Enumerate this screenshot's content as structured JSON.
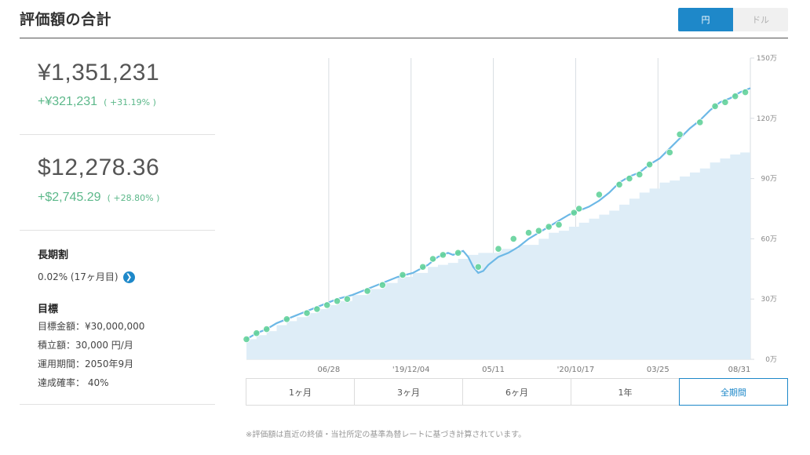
{
  "header": {
    "title": "評価額の合計",
    "currency_yen": "円",
    "currency_usd": "ドル"
  },
  "summary": {
    "yen_total": "¥1,351,231",
    "yen_gain": "+¥321,231",
    "yen_gain_pct": "( +31.19% )",
    "usd_total": "$12,278.36",
    "usd_gain": "+$2,745.29",
    "usd_gain_pct": "( +28.80% )"
  },
  "long_term": {
    "heading": "長期割",
    "value": "0.02% (17ヶ月目)",
    "arrow": "❯"
  },
  "goal": {
    "heading": "目標",
    "amount": "目標金額：¥30,000,000",
    "monthly": "積立額：30,000 円/月",
    "period": "運用期間：2050年9月",
    "probability": "達成確率： 40%"
  },
  "period_tabs": [
    "1ヶ月",
    "3ヶ月",
    "6ヶ月",
    "1年",
    "全期間"
  ],
  "active_period_index": 4,
  "footnote": "※評価額は直近の終値・当社所定の基準為替レートに基づき計算されています。",
  "chart_data": {
    "type": "area",
    "x_tick_labels": [
      "06/28",
      "'19/12/04",
      "05/11",
      "'20/10/17",
      "03/25",
      "08/31"
    ],
    "y_tick_labels": [
      "0万",
      "30万",
      "60万",
      "90万",
      "120万",
      "150万"
    ],
    "ylim": [
      0,
      150
    ],
    "y_unit": "万",
    "grid": "vertical",
    "colors": {
      "line": "#6cb8e6",
      "fill": "#deedf7",
      "marker": "#63d29a",
      "grid": "#d8dde2"
    },
    "series": [
      {
        "values": [
          [
            0,
            10
          ],
          [
            0.02,
            13
          ],
          [
            0.04,
            15
          ],
          [
            0.06,
            18
          ],
          [
            0.08,
            20
          ],
          [
            0.1,
            22
          ],
          [
            0.12,
            24
          ],
          [
            0.14,
            26
          ],
          [
            0.16,
            28
          ],
          [
            0.18,
            30
          ],
          [
            0.21,
            32
          ],
          [
            0.24,
            35
          ],
          [
            0.27,
            38
          ],
          [
            0.3,
            41
          ],
          [
            0.33,
            43
          ],
          [
            0.36,
            47
          ],
          [
            0.38,
            51
          ],
          [
            0.4,
            53
          ],
          [
            0.41,
            52
          ],
          [
            0.42,
            53
          ],
          [
            0.43,
            54
          ],
          [
            0.44,
            51
          ],
          [
            0.45,
            46
          ],
          [
            0.46,
            43
          ],
          [
            0.47,
            44
          ],
          [
            0.48,
            47
          ],
          [
            0.5,
            51
          ],
          [
            0.52,
            53
          ],
          [
            0.54,
            56
          ],
          [
            0.56,
            60
          ],
          [
            0.58,
            63
          ],
          [
            0.6,
            66
          ],
          [
            0.62,
            69
          ],
          [
            0.64,
            72
          ],
          [
            0.66,
            74
          ],
          [
            0.68,
            76
          ],
          [
            0.7,
            79
          ],
          [
            0.72,
            83
          ],
          [
            0.74,
            88
          ],
          [
            0.76,
            91
          ],
          [
            0.78,
            93
          ],
          [
            0.8,
            97
          ],
          [
            0.82,
            100
          ],
          [
            0.84,
            105
          ],
          [
            0.86,
            110
          ],
          [
            0.88,
            115
          ],
          [
            0.9,
            119
          ],
          [
            0.92,
            124
          ],
          [
            0.94,
            128
          ],
          [
            0.96,
            130
          ],
          [
            0.98,
            133
          ],
          [
            1.0,
            135
          ]
        ]
      },
      {
        "values": [
          [
            0,
            10
          ],
          [
            0.02,
            12
          ],
          [
            0.04,
            14
          ],
          [
            0.06,
            17
          ],
          [
            0.08,
            19
          ],
          [
            0.1,
            21
          ],
          [
            0.12,
            23
          ],
          [
            0.14,
            25
          ],
          [
            0.16,
            27
          ],
          [
            0.18,
            29
          ],
          [
            0.21,
            32
          ],
          [
            0.24,
            35
          ],
          [
            0.27,
            38
          ],
          [
            0.3,
            41
          ],
          [
            0.33,
            43
          ],
          [
            0.36,
            46
          ],
          [
            0.38,
            47
          ],
          [
            0.4,
            48
          ],
          [
            0.42,
            50
          ],
          [
            0.44,
            52
          ],
          [
            0.46,
            53
          ],
          [
            0.5,
            55
          ],
          [
            0.54,
            57
          ],
          [
            0.58,
            60
          ],
          [
            0.6,
            63
          ],
          [
            0.62,
            64
          ],
          [
            0.64,
            66
          ],
          [
            0.66,
            68
          ],
          [
            0.68,
            70
          ],
          [
            0.7,
            72
          ],
          [
            0.72,
            74
          ],
          [
            0.74,
            77
          ],
          [
            0.76,
            80
          ],
          [
            0.78,
            83
          ],
          [
            0.8,
            85
          ],
          [
            0.82,
            88
          ],
          [
            0.84,
            89
          ],
          [
            0.86,
            91
          ],
          [
            0.88,
            93
          ],
          [
            0.9,
            95
          ],
          [
            0.92,
            98
          ],
          [
            0.94,
            100
          ],
          [
            0.96,
            102
          ],
          [
            0.98,
            103
          ],
          [
            1.0,
            103
          ]
        ]
      }
    ],
    "markers": [
      [
        0,
        10
      ],
      [
        0.02,
        13
      ],
      [
        0.04,
        15
      ],
      [
        0.08,
        20
      ],
      [
        0.12,
        23
      ],
      [
        0.14,
        25
      ],
      [
        0.16,
        27
      ],
      [
        0.18,
        29
      ],
      [
        0.2,
        30
      ],
      [
        0.24,
        34
      ],
      [
        0.27,
        37
      ],
      [
        0.31,
        42
      ],
      [
        0.35,
        46
      ],
      [
        0.37,
        50
      ],
      [
        0.39,
        52
      ],
      [
        0.42,
        53
      ],
      [
        0.46,
        46
      ],
      [
        0.5,
        55
      ],
      [
        0.53,
        60
      ],
      [
        0.56,
        63
      ],
      [
        0.58,
        64
      ],
      [
        0.6,
        66
      ],
      [
        0.62,
        67
      ],
      [
        0.65,
        73
      ],
      [
        0.66,
        75
      ],
      [
        0.7,
        82
      ],
      [
        0.74,
        87
      ],
      [
        0.76,
        90
      ],
      [
        0.78,
        92
      ],
      [
        0.8,
        97
      ],
      [
        0.84,
        103
      ],
      [
        0.86,
        112
      ],
      [
        0.9,
        118
      ],
      [
        0.93,
        126
      ],
      [
        0.95,
        128
      ],
      [
        0.97,
        131
      ],
      [
        0.99,
        133
      ]
    ]
  }
}
